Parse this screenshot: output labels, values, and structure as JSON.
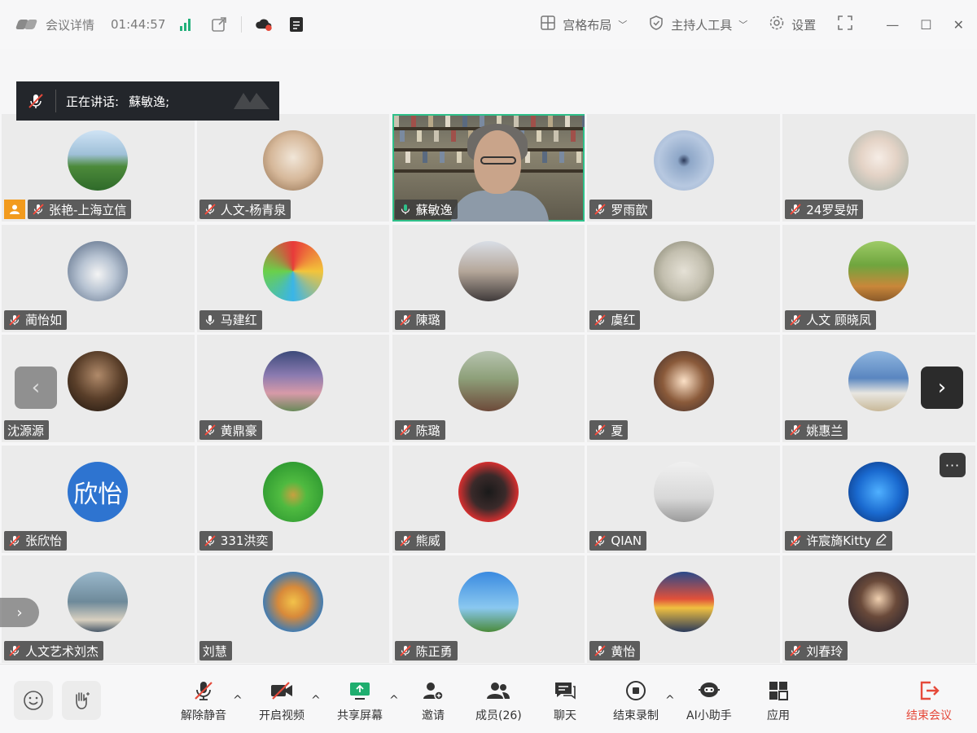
{
  "titlebar": {
    "meeting_info": "会议详情",
    "timer": "01:44:57",
    "layout_label": "宫格布局",
    "host_tools_label": "主持人工具",
    "settings_label": "设置"
  },
  "speaking_banner": {
    "prefix": "正在讲话:",
    "names": "蘇敏逸;"
  },
  "participants": [
    {
      "name": "张艳-上海立信",
      "mic": "off",
      "host": true
    },
    {
      "name": "人文-杨青泉",
      "mic": "off"
    },
    {
      "name": "蘇敏逸",
      "mic": "on",
      "video": true
    },
    {
      "name": "罗雨歆",
      "mic": "off"
    },
    {
      "name": "24罗旻妍",
      "mic": "off"
    },
    {
      "name": "蔺怡如",
      "mic": "off"
    },
    {
      "name": "马建红",
      "mic": "on"
    },
    {
      "name": "陳璐",
      "mic": "off"
    },
    {
      "name": "虞红",
      "mic": "off"
    },
    {
      "name": "人文 顾晓凤",
      "mic": "off"
    },
    {
      "name": "沈源源",
      "mic": "none"
    },
    {
      "name": "黄鼎豪",
      "mic": "off"
    },
    {
      "name": "陈璐",
      "mic": "off"
    },
    {
      "name": "夏",
      "mic": "off"
    },
    {
      "name": "姚惠兰",
      "mic": "off"
    },
    {
      "name": "张欣怡",
      "mic": "off",
      "avatar_text": "欣怡"
    },
    {
      "name": "331洪奕",
      "mic": "off"
    },
    {
      "name": "熊威",
      "mic": "off"
    },
    {
      "name": "QIAN",
      "mic": "off"
    },
    {
      "name": "许宸旖Kitty",
      "mic": "off",
      "edit": true
    },
    {
      "name": "人文艺术刘杰",
      "mic": "off"
    },
    {
      "name": "刘慧",
      "mic": "none"
    },
    {
      "name": "陈正勇",
      "mic": "off"
    },
    {
      "name": "黄怡",
      "mic": "off"
    },
    {
      "name": "刘春玲",
      "mic": "off"
    }
  ],
  "toolbar": {
    "unmute": "解除静音",
    "start_video": "开启视频",
    "share_screen": "共享屏幕",
    "invite": "邀请",
    "members": "成员(26)",
    "chat": "聊天",
    "stop_recording": "结束录制",
    "ai_assistant": "AI小助手",
    "apps": "应用",
    "end_meeting": "结束会议"
  },
  "colors": {
    "accent_green": "#2fc08a",
    "host_orange": "#f29b1e",
    "end_red": "#e5493a"
  },
  "icons": [
    "logo-icon",
    "signal-icon",
    "popout-icon",
    "cloud-record-icon",
    "notes-icon",
    "grid-icon",
    "shield-icon",
    "gear-icon",
    "fullscreen-icon",
    "minimize-icon",
    "maximize-icon",
    "close-icon",
    "mic-off-icon",
    "mic-icon",
    "emoji-icon",
    "raise-hand-icon",
    "video-off-icon",
    "share-screen-icon",
    "add-user-icon",
    "members-icon",
    "chat-icon",
    "record-stop-icon",
    "ai-icon",
    "apps-icon",
    "leave-icon",
    "chevron-left-icon",
    "chevron-right-icon",
    "more-icon"
  ]
}
